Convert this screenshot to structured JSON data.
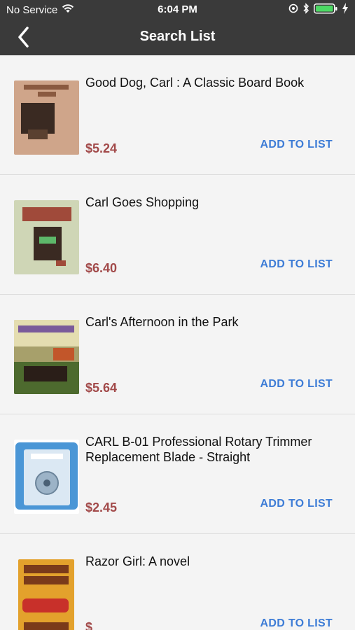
{
  "status_bar": {
    "carrier": "No Service",
    "time": "6:04 PM"
  },
  "nav": {
    "title": "Search List"
  },
  "items": [
    {
      "title": "Good Dog, Carl : A Classic Board Book",
      "price": "$5.24",
      "action": "ADD TO LIST",
      "cover_color": "#cfa58a"
    },
    {
      "title": "Carl Goes Shopping",
      "price": "$6.40",
      "action": "ADD TO LIST",
      "cover_color": "#cfd6b6"
    },
    {
      "title": "Carl's Afternoon in the Park",
      "price": "$5.64",
      "action": "ADD TO LIST",
      "cover_color": "#a7a06b"
    },
    {
      "title": "CARL B-01 Professional Rotary Trimmer Replacement Blade - Straight",
      "price": "$2.45",
      "action": "ADD TO LIST",
      "cover_color": "#4a96d6"
    },
    {
      "title": "Razor Girl: A novel",
      "price": "$",
      "action": "ADD TO LIST",
      "cover_color": "#e3a12c"
    }
  ],
  "colors": {
    "header": "#3a3a3a",
    "price": "#a24a4a",
    "action": "#3d7cd6"
  },
  "icons": [
    "wifi-icon",
    "location-icon",
    "bluetooth-icon",
    "battery-icon",
    "charging-icon",
    "back-chevron-icon"
  ]
}
